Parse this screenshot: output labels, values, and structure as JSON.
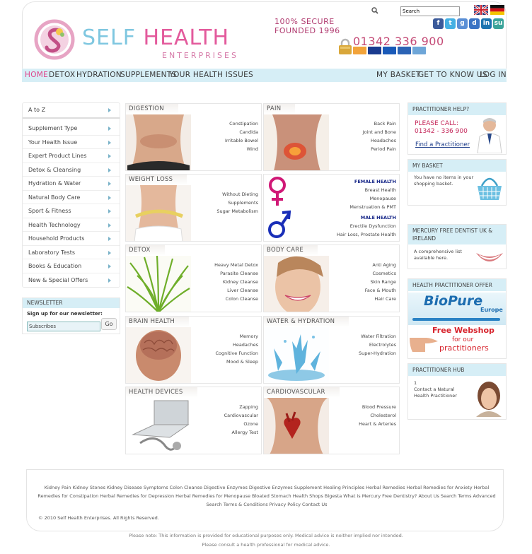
{
  "brand": {
    "name_part1": "SELF",
    "name_part2": " HEALTH",
    "subtitle": "ENTERPRISES",
    "tagline_line1": "100% SECURE",
    "tagline_line2": "FOUNDED 1996",
    "phone": "01342 336 900",
    "accent": "#e0458c",
    "nav_bg": "#d6eef6"
  },
  "search": {
    "placeholder": "Search"
  },
  "nav": {
    "left": [
      "HOME",
      "DETOX",
      "HYDRATION",
      "SUPPLEMENTS",
      "YOUR HEALTH ISSUES"
    ],
    "right": [
      "MY BASKET",
      "GET TO KNOW US",
      "LOG IN"
    ]
  },
  "sidebar": {
    "atoz": "A to Z",
    "items": [
      "Supplement Type",
      "Your Health Issue",
      "Expert Product Lines",
      "Detox & Cleansing",
      "Hydration & Water",
      "Natural Body Care",
      "Sport & Fitness",
      "Health Technology",
      "Household Products",
      "Laboratory Tests",
      "Books & Education",
      "New & Special Offers"
    ]
  },
  "newsletter": {
    "title": "NEWSLETTER",
    "signup": "Sign up for our newsletter:",
    "input_value": "Subscribes",
    "go": "Go"
  },
  "tiles": [
    {
      "title": "DIGESTION",
      "links": [
        "Constipation",
        "Candida",
        "Irritable Bowel",
        "Wind"
      ]
    },
    {
      "title": "PAIN",
      "links": [
        "Back Pain",
        "Joint and Bone",
        "Headaches",
        "Period Pain"
      ]
    },
    {
      "title": "WEIGHT LOSS",
      "links": [
        "Without Dieting",
        "Supplements",
        "Sugar Metabolism"
      ]
    },
    {
      "title": "",
      "female_title": "FEMALE HEALTH",
      "female_links": [
        "Breast Health",
        "Menopause",
        "Menstruation & PMT"
      ],
      "male_title": "MALE HEALTH",
      "male_links": [
        "Erectile Dysfunction",
        "Hair Loss,  Prostate Health"
      ]
    },
    {
      "title": "DETOX",
      "links": [
        "Heavy Metal Detox",
        "Parasite Cleanse",
        "Kidney Cleanse",
        "Liver Cleanse",
        "Colon Cleanse"
      ]
    },
    {
      "title": "BODY CARE",
      "links": [
        "Anti Aging",
        "Cosmetics",
        "Skin Range",
        "Face & Mouth",
        "Hair Care"
      ]
    },
    {
      "title": "BRAIN HEALTH",
      "links": [
        "Memory",
        "Headaches",
        "Cognitive Function",
        "Mood & Sleep"
      ]
    },
    {
      "title": "WATER & HYDRATION",
      "links": [
        "Water Filtration",
        "Electrolytes",
        "Super-Hydration"
      ]
    },
    {
      "title": "HEALTH DEVICES",
      "links": [
        "Zapping",
        "Cardiovascular",
        "Ozone",
        "Allergy Test"
      ]
    },
    {
      "title": "CARDIOVASCULAR",
      "links": [
        "Blood Pressure",
        "Cholesterol",
        "Heart & Arteries"
      ]
    }
  ],
  "right": {
    "practitioner_help": {
      "title": "PRACTITIONER HELP?",
      "call": "PLEASE CALL:",
      "phone": "01342 - 336  900",
      "find": "Find a Practitioner"
    },
    "basket": {
      "title": "MY  BASKET",
      "text": "You have no items in your shopping basket."
    },
    "dentist": {
      "title": "MERCURY FREE DENTIST UK & IRELAND",
      "text": "A comprehensive list available here."
    },
    "offer": {
      "title": "HEALTH PRACTITIONER OFFER",
      "biopure": "BioPure",
      "europe": "Europe",
      "tm": "TM",
      "webshop1": "Free Webshop",
      "webshop2": "for our",
      "webshop3": "practitioners"
    },
    "hub": {
      "title": "PRACTITIONER HUB",
      "num": "1",
      "text": "Contact a Natural Health Practitioner"
    }
  },
  "footer": {
    "links": "Kidney Pain Kidney Stones Kidney Disease Symptoms Colon Cleanse Digestive Enzymes Digestive Enzymes Supplement Healing Principles Herbal Remedies Herbal Remedies for Anxiety Herbal Remedies for Constipation Herbal Remedies for Depression Herbal Remedies for Menopause Bloated Stomach Health Shops Bigesta What is Mercury Free Dentistry? About Us Search Terms Advanced Search Terms & Conditions Privacy Policy Contact Us",
    "copyright": "© 2010 Self Health Enterprises. All Rights Reserved.",
    "disclaimer1": "Please note: This information is provided for educational purposes only. Medical advice is neither implied nor intended.",
    "disclaimer2": "Please consult a health professional for medical advice."
  },
  "icons": [
    "search-icon",
    "flag-uk-icon",
    "flag-de-icon",
    "facebook-icon",
    "twitter-icon",
    "google-icon",
    "delicious-icon",
    "linkedin-icon",
    "stumbleupon-icon",
    "padlock-icon"
  ]
}
